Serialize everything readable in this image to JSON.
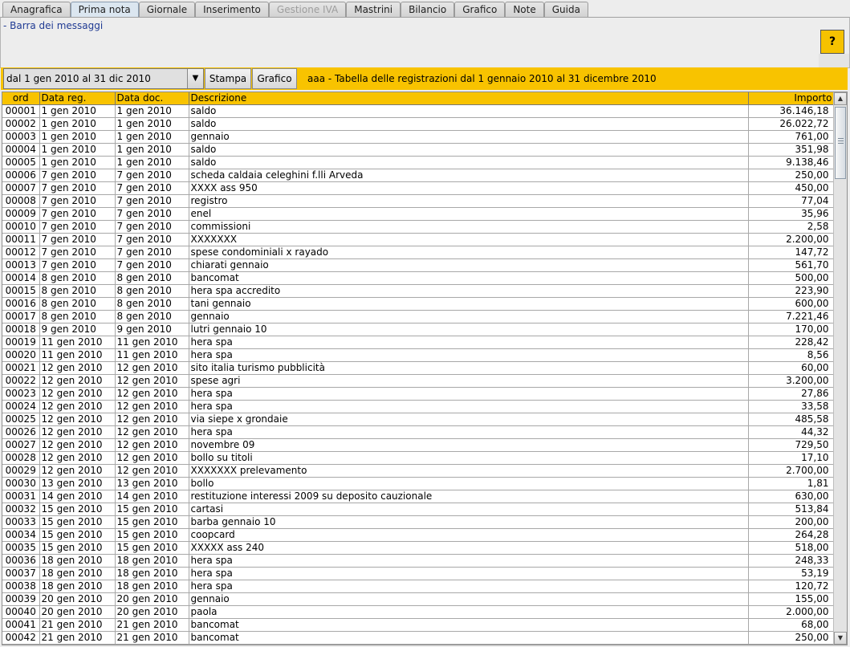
{
  "tabs": [
    {
      "label": "Anagrafica",
      "state": "normal"
    },
    {
      "label": "Prima nota",
      "state": "active"
    },
    {
      "label": "Giornale",
      "state": "normal"
    },
    {
      "label": "Inserimento",
      "state": "normal"
    },
    {
      "label": "Gestione IVA",
      "state": "disabled"
    },
    {
      "label": "Mastrini",
      "state": "normal"
    },
    {
      "label": "Bilancio",
      "state": "normal"
    },
    {
      "label": "Grafico",
      "state": "normal"
    },
    {
      "label": "Note",
      "state": "normal"
    },
    {
      "label": "Guida",
      "state": "normal"
    }
  ],
  "message_bar": {
    "text": "- Barra dei messaggi",
    "help_label": "?"
  },
  "toolbar": {
    "period_selected": "dal 1 gen 2010 al 31 dic 2010",
    "print_label": "Stampa",
    "chart_label": "Grafico",
    "title": "aaa - Tabella delle registrazioni dal 1 gennaio 2010 al 31 dicembre 2010"
  },
  "colors": {
    "accent": "#f8c300",
    "message_text": "#1f3a93"
  },
  "table": {
    "columns": [
      "ord",
      "Data reg.",
      "Data doc.",
      "Descrizione",
      "Importo"
    ],
    "rows": [
      [
        "00001",
        "1 gen 2010",
        "1 gen 2010",
        "saldo",
        "36.146,18"
      ],
      [
        "00002",
        "1 gen 2010",
        "1 gen 2010",
        "saldo",
        "26.022,72"
      ],
      [
        "00003",
        "1 gen 2010",
        "1 gen 2010",
        "gennaio",
        "761,00"
      ],
      [
        "00004",
        "1 gen 2010",
        "1 gen 2010",
        "saldo",
        "351,98"
      ],
      [
        "00005",
        "1 gen 2010",
        "1 gen 2010",
        "saldo",
        "9.138,46"
      ],
      [
        "00006",
        "7 gen 2010",
        "7 gen 2010",
        "scheda caldaia celeghini  f.lli Arveda",
        "250,00"
      ],
      [
        "00007",
        "7 gen 2010",
        "7 gen 2010",
        "XXXX ass 950",
        "450,00"
      ],
      [
        "00008",
        "7 gen 2010",
        "7 gen 2010",
        "registro",
        "77,04"
      ],
      [
        "00009",
        "7 gen 2010",
        "7 gen 2010",
        "enel",
        "35,96"
      ],
      [
        "00010",
        "7 gen 2010",
        "7 gen 2010",
        "commissioni",
        "2,58"
      ],
      [
        "00011",
        "7 gen 2010",
        "7 gen 2010",
        "XXXXXXX",
        "2.200,00"
      ],
      [
        "00012",
        "7 gen 2010",
        "7 gen 2010",
        "spese condominiali x rayado",
        "147,72"
      ],
      [
        "00013",
        "7 gen 2010",
        "7 gen 2010",
        "chiarati gennaio",
        "561,70"
      ],
      [
        "00014",
        "8 gen 2010",
        "8 gen 2010",
        "bancomat",
        "500,00"
      ],
      [
        "00015",
        "8 gen 2010",
        "8 gen 2010",
        "hera spa accredito",
        "223,90"
      ],
      [
        "00016",
        "8 gen 2010",
        "8 gen 2010",
        "tani gennaio",
        "600,00"
      ],
      [
        "00017",
        "8 gen 2010",
        "8 gen 2010",
        "gennaio",
        "7.221,46"
      ],
      [
        "00018",
        "9 gen 2010",
        "9 gen 2010",
        "lutri gennaio 10",
        "170,00"
      ],
      [
        "00019",
        "11 gen 2010",
        "11 gen 2010",
        "hera spa",
        "228,42"
      ],
      [
        "00020",
        "11 gen 2010",
        "11 gen 2010",
        "hera spa",
        "8,56"
      ],
      [
        "00021",
        "12 gen 2010",
        "12 gen 2010",
        "sito italia turismo pubblicità",
        "60,00"
      ],
      [
        "00022",
        "12 gen 2010",
        "12 gen 2010",
        "spese agri",
        "3.200,00"
      ],
      [
        "00023",
        "12 gen 2010",
        "12 gen 2010",
        "hera spa",
        "27,86"
      ],
      [
        "00024",
        "12 gen 2010",
        "12 gen 2010",
        "hera spa",
        "33,58"
      ],
      [
        "00025",
        "12 gen 2010",
        "12 gen 2010",
        "via siepe x grondaie",
        "485,58"
      ],
      [
        "00026",
        "12 gen 2010",
        "12 gen 2010",
        "hera spa",
        "44,32"
      ],
      [
        "00027",
        "12 gen 2010",
        "12 gen 2010",
        "novembre 09",
        "729,50"
      ],
      [
        "00028",
        "12 gen 2010",
        "12 gen 2010",
        "bollo su titoli",
        "17,10"
      ],
      [
        "00029",
        "12 gen 2010",
        "12 gen 2010",
        "XXXXXXX prelevamento",
        "2.700,00"
      ],
      [
        "00030",
        "13 gen 2010",
        "13 gen 2010",
        "bollo",
        "1,81"
      ],
      [
        "00031",
        "14 gen 2010",
        "14 gen 2010",
        "restituzione interessi 2009 su deposito cauzionale",
        "630,00"
      ],
      [
        "00032",
        "15 gen 2010",
        "15 gen 2010",
        "cartasi",
        "513,84"
      ],
      [
        "00033",
        "15 gen 2010",
        "15 gen 2010",
        "barba gennaio 10",
        "200,00"
      ],
      [
        "00034",
        "15 gen 2010",
        "15 gen 2010",
        "coopcard",
        "264,28"
      ],
      [
        "00035",
        "15 gen 2010",
        "15 gen 2010",
        "XXXXX ass 240",
        "518,00"
      ],
      [
        "00036",
        "18 gen 2010",
        "18 gen 2010",
        "hera spa",
        "248,33"
      ],
      [
        "00037",
        "18 gen 2010",
        "18 gen 2010",
        "hera spa",
        "53,19"
      ],
      [
        "00038",
        "18 gen 2010",
        "18 gen 2010",
        "hera spa",
        "120,72"
      ],
      [
        "00039",
        "20 gen 2010",
        "20 gen 2010",
        "gennaio",
        "155,00"
      ],
      [
        "00040",
        "20 gen 2010",
        "20 gen 2010",
        "paola",
        "2.000,00"
      ],
      [
        "00041",
        "21 gen 2010",
        "21 gen 2010",
        "bancomat",
        "68,00"
      ],
      [
        "00042",
        "21 gen 2010",
        "21 gen 2010",
        "bancomat",
        "250,00"
      ]
    ]
  }
}
